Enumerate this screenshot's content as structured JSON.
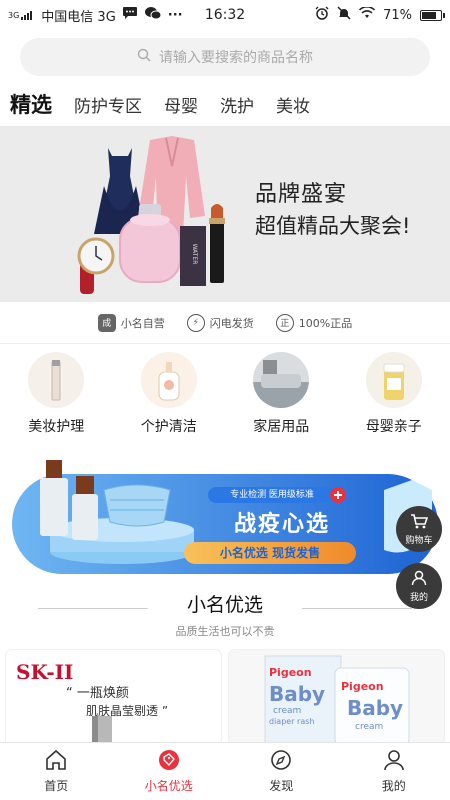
{
  "status_bar": {
    "network": "3G",
    "carrier": "中国电信 3G",
    "time": "16:32",
    "battery": "71%",
    "battery_level": 0.71,
    "more": "···"
  },
  "search": {
    "placeholder": "请输入要搜索的商品名称"
  },
  "tabs": [
    {
      "label": "精选",
      "active": true
    },
    {
      "label": "防护专区"
    },
    {
      "label": "母婴"
    },
    {
      "label": "洗护"
    },
    {
      "label": "美妆"
    }
  ],
  "banner": {
    "title": "品牌盛宴",
    "subtitle": "超值精品大聚会!",
    "perfume_label": "WATER"
  },
  "assurances": [
    {
      "icon": "成",
      "label": "小名自营"
    },
    {
      "icon": "⚡",
      "label": "闪电发货"
    },
    {
      "icon": "正",
      "label": "100%正品"
    }
  ],
  "categories": [
    {
      "label": "美妆护理"
    },
    {
      "label": "个护清洁"
    },
    {
      "label": "家居用品"
    },
    {
      "label": "母婴亲子"
    }
  ],
  "promo": {
    "tag": "专业检测 医用级标准",
    "title": "战疫心选",
    "slogan": "小名优选 现货发售"
  },
  "fabs": {
    "cart": "购物车",
    "mine": "我的"
  },
  "section": {
    "title": "小名优选",
    "subtitle": "品质生活也可以不贵"
  },
  "products": [
    {
      "brand": "SK-II",
      "line1": "“ 一瓶焕颜",
      "line2": "肌肤晶莹剔透 ”"
    },
    {
      "brand": "Pigeon",
      "name": "Baby",
      "sub1": "cream",
      "sub2": "diaper rash",
      "sub3": "cream"
    }
  ],
  "bottom_nav": [
    {
      "label": "首页"
    },
    {
      "label": "小名优选",
      "active": true
    },
    {
      "label": "发现"
    },
    {
      "label": "我的"
    }
  ],
  "colors": {
    "accent": "#e8323e",
    "promo_blue": "#1e6fd9",
    "promo_orange": "#f4a32b"
  }
}
